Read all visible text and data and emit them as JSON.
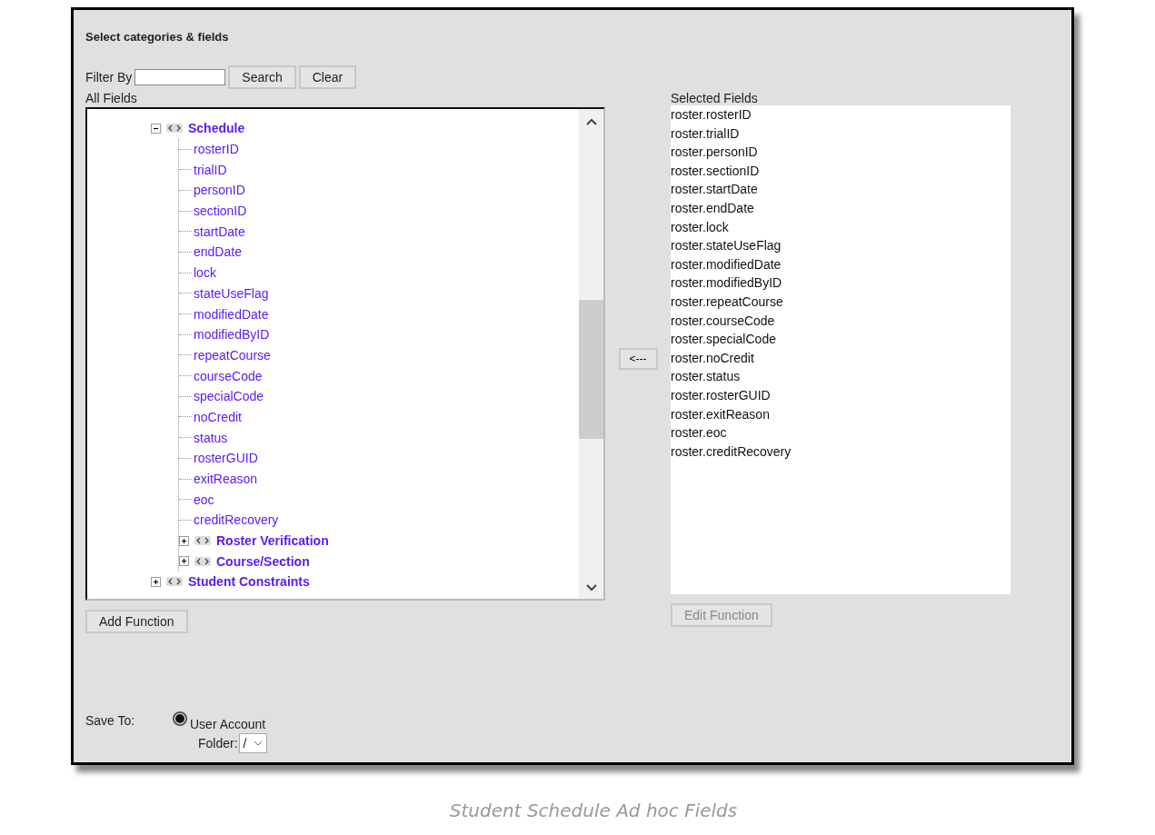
{
  "panel": {
    "title": "Select categories & fields"
  },
  "filter": {
    "label": "Filter By",
    "buttons": [
      "Search",
      "Clear"
    ]
  },
  "all_fields": {
    "label": "All Fields",
    "tree": [
      {
        "label": "Schedule",
        "kind": "category",
        "expanded": true,
        "children": [
          {
            "label": "rosterID",
            "kind": "field"
          },
          {
            "label": "trialID",
            "kind": "field"
          },
          {
            "label": "personID",
            "kind": "field"
          },
          {
            "label": "sectionID",
            "kind": "field"
          },
          {
            "label": "startDate",
            "kind": "field"
          },
          {
            "label": "endDate",
            "kind": "field"
          },
          {
            "label": "lock",
            "kind": "field"
          },
          {
            "label": "stateUseFlag",
            "kind": "field"
          },
          {
            "label": "modifiedDate",
            "kind": "field"
          },
          {
            "label": "modifiedByID",
            "kind": "field"
          },
          {
            "label": "repeatCourse",
            "kind": "field"
          },
          {
            "label": "courseCode",
            "kind": "field"
          },
          {
            "label": "specialCode",
            "kind": "field"
          },
          {
            "label": "noCredit",
            "kind": "field"
          },
          {
            "label": "status",
            "kind": "field"
          },
          {
            "label": "rosterGUID",
            "kind": "field"
          },
          {
            "label": "exitReason",
            "kind": "field"
          },
          {
            "label": "eoc",
            "kind": "field"
          },
          {
            "label": "creditRecovery",
            "kind": "field"
          },
          {
            "label": "Roster Verification",
            "kind": "category",
            "expanded": false
          },
          {
            "label": "Course/Section",
            "kind": "category",
            "expanded": false
          }
        ]
      },
      {
        "label": "Student Constraints",
        "kind": "category",
        "expanded": false
      }
    ],
    "button": "Add Function"
  },
  "move_button": "<---",
  "selected_fields": {
    "label": "Selected Fields",
    "items": [
      "roster.rosterID",
      "roster.trialID",
      "roster.personID",
      "roster.sectionID",
      "roster.startDate",
      "roster.endDate",
      "roster.lock",
      "roster.stateUseFlag",
      "roster.modifiedDate",
      "roster.modifiedByID",
      "roster.repeatCourse",
      "roster.courseCode",
      "roster.specialCode",
      "roster.noCredit",
      "roster.status",
      "roster.rosterGUID",
      "roster.exitReason",
      "roster.eoc",
      "roster.creditRecovery"
    ],
    "button": {
      "label": "Edit Function",
      "disabled": true
    }
  },
  "save_to": {
    "label": "Save To:",
    "option": {
      "label": "User Account",
      "selected": true
    },
    "folder_label": "Folder:",
    "folder_value": "/"
  },
  "caption": "Student Schedule Ad hoc Fields"
}
